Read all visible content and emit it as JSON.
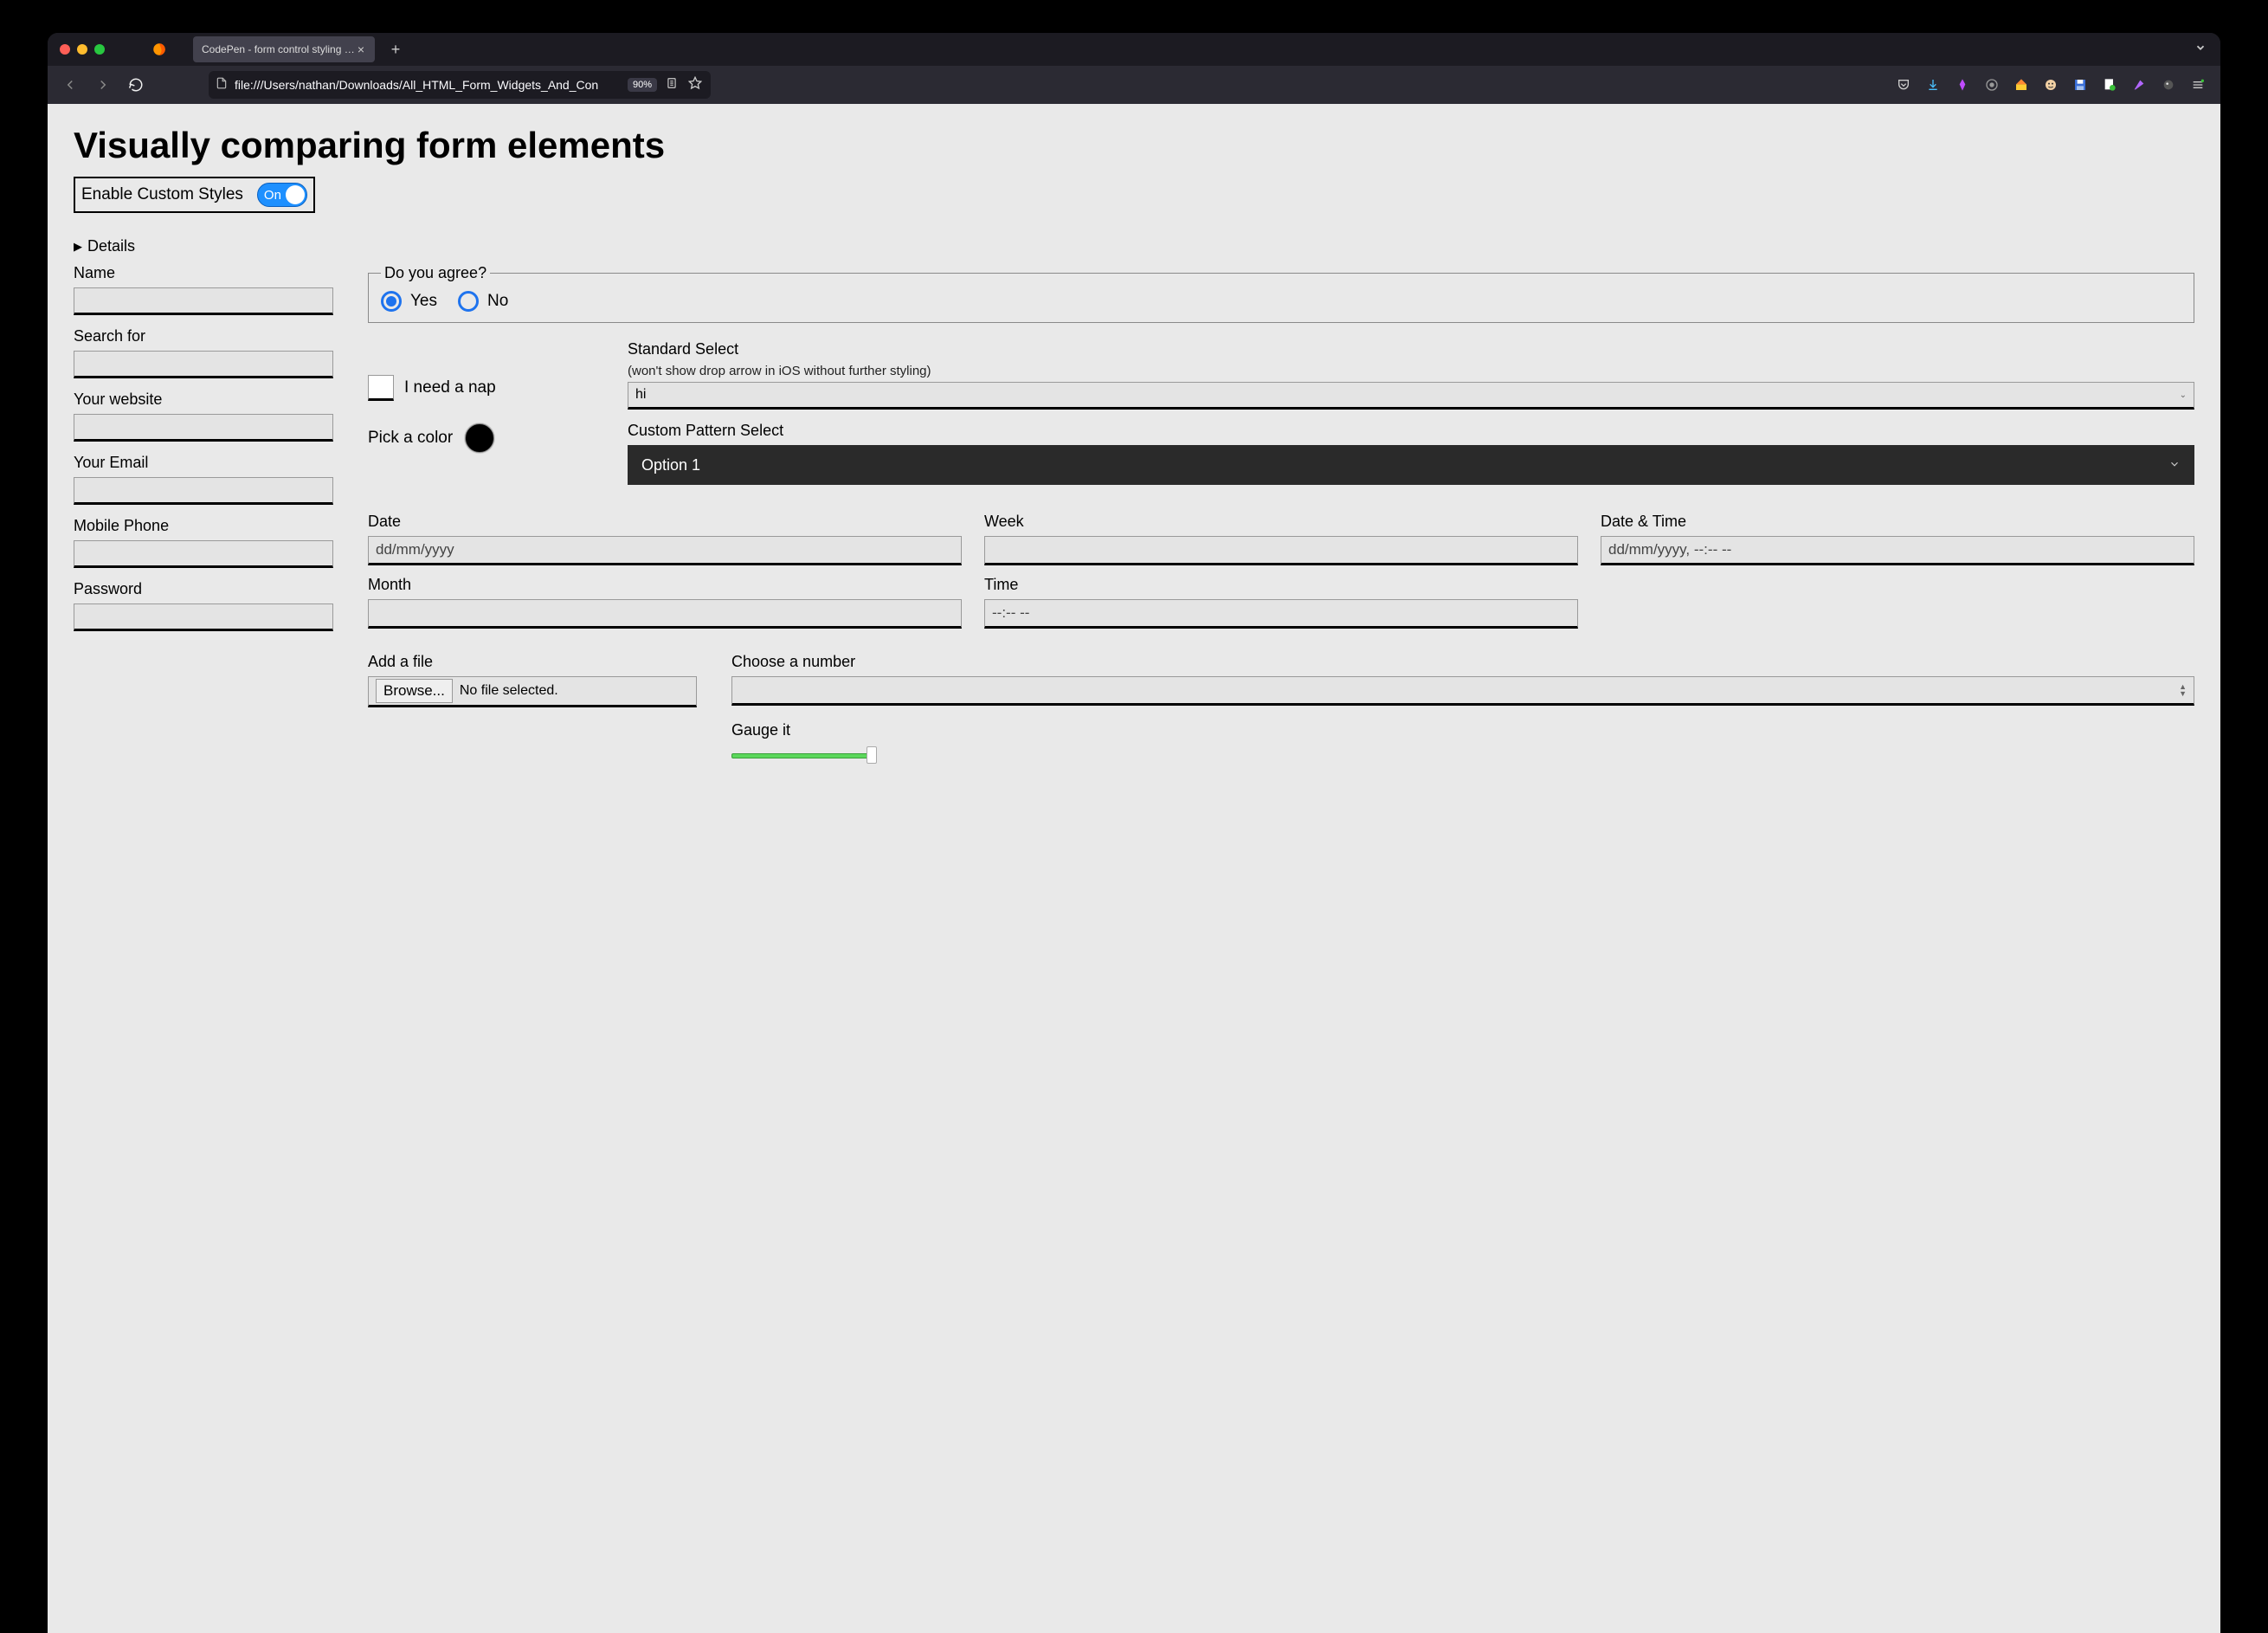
{
  "browser": {
    "tab_title": "CodePen - form control styling comp",
    "url": "file:///Users/nathan/Downloads/All_HTML_Form_Widgets_And_Con",
    "zoom": "90%"
  },
  "page": {
    "heading": "Visually comparing form elements",
    "toggle_label": "Enable Custom Styles",
    "toggle_state": "On",
    "details_label": "Details",
    "text_fields": {
      "name": "Name",
      "search": "Search for",
      "website": "Your website",
      "email": "Your Email",
      "phone": "Mobile Phone",
      "password": "Password"
    },
    "agree": {
      "legend": "Do you agree?",
      "yes": "Yes",
      "no": "No"
    },
    "checkbox_label": "I need a nap",
    "color_label": "Pick a color",
    "standard_select": {
      "label": "Standard Select",
      "note": "(won't show drop arrow in iOS without further styling)",
      "value": "hi"
    },
    "custom_select": {
      "label": "Custom Pattern Select",
      "value": "Option 1"
    },
    "date_labels": {
      "date": "Date",
      "week": "Week",
      "datetime": "Date & Time",
      "month": "Month",
      "time": "Time"
    },
    "date_placeholders": {
      "date": "dd/mm/yyyy",
      "datetime": "dd/mm/yyyy, --:-- --",
      "time": "--:-- --"
    },
    "file": {
      "label": "Add a file",
      "button": "Browse...",
      "status": "No file selected."
    },
    "number_label": "Choose a number",
    "gauge_label": "Gauge it"
  }
}
